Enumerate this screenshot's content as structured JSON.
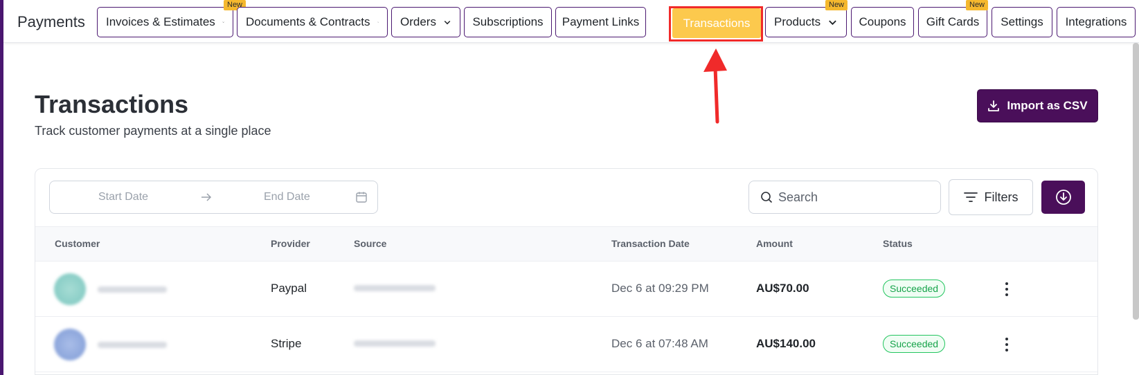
{
  "app": {
    "brand": "Payments"
  },
  "nav": {
    "tabs": [
      {
        "id": "invoices",
        "label": "Invoices & Estimates",
        "badge": "New",
        "dropdown": true
      },
      {
        "id": "documents",
        "label": "Documents & Contracts",
        "dropdown": true
      },
      {
        "id": "orders",
        "label": "Orders",
        "dropdown": true
      },
      {
        "id": "subscriptions",
        "label": "Subscriptions"
      },
      {
        "id": "payment-links",
        "label": "Payment Links"
      },
      {
        "id": "transactions",
        "label": "Transactions",
        "active": true
      },
      {
        "id": "products",
        "label": "Products",
        "badge": "New",
        "dropdown": true
      },
      {
        "id": "coupons",
        "label": "Coupons"
      },
      {
        "id": "gift-cards",
        "label": "Gift Cards",
        "badge": "New"
      },
      {
        "id": "settings",
        "label": "Settings"
      },
      {
        "id": "integrations",
        "label": "Integrations"
      }
    ]
  },
  "header": {
    "title": "Transactions",
    "subtitle": "Track customer payments at a single place",
    "import_label": "Import as CSV"
  },
  "toolbar": {
    "start_date_placeholder": "Start Date",
    "end_date_placeholder": "End Date",
    "search_placeholder": "Search",
    "filters_label": "Filters"
  },
  "table": {
    "columns": [
      "Customer",
      "Provider",
      "Source",
      "Transaction Date",
      "Amount",
      "Status"
    ],
    "rows": [
      {
        "provider": "Paypal",
        "date": "Dec 6 at 09:29 PM",
        "amount": "AU$70.00",
        "status": "Succeeded"
      },
      {
        "provider": "Stripe",
        "date": "Dec 6 at 07:48 AM",
        "amount": "AU$140.00",
        "status": "Succeeded"
      }
    ]
  },
  "colors": {
    "brand_purple": "#4a0f5a",
    "active_tab": "#fcc94d",
    "highlight_red": "#f02a2a",
    "success_green": "#16a34a"
  }
}
